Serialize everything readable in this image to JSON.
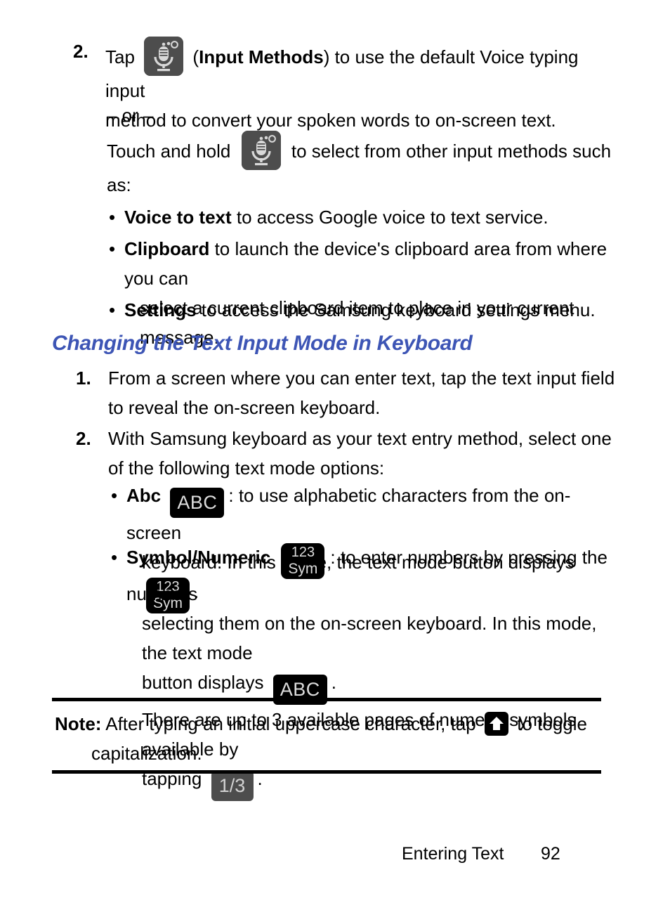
{
  "page": {
    "number": "92",
    "footer_section": "Entering Text"
  },
  "step2_input_methods": {
    "marker": "2.",
    "text_before_icon": "Tap",
    "icon": "microphone-input-methods-icon",
    "text_after_icon_bold": "Input Methods",
    "text_line1_tail": ") to use the default Voice typing input",
    "text_line2": "method to convert your spoken words to on-screen text.",
    "open_paren": "(",
    "or_separator": "– or –",
    "touch_hold_before": "Touch and hold",
    "touch_hold_icon": "microphone-input-methods-icon",
    "touch_hold_after": "to select from other input methods such",
    "touch_hold_line2": "as:"
  },
  "input_method_bullets": [
    {
      "bullet": "•",
      "term": "Voice to text",
      "description": " to access Google voice to text service."
    },
    {
      "bullet": "•",
      "term": "Clipboard",
      "description": " to launch the device's clipboard area from where you can",
      "description_line2": "select a current clipboard item to place in your current message."
    },
    {
      "bullet": "•",
      "term": "Settings",
      "description": " to access the Samsung keyboard settings menu."
    }
  ],
  "section_heading": "Changing the Text Input Mode in Keyboard",
  "mode_steps": [
    {
      "marker": "1.",
      "line1": "From a screen where you can enter text, tap the text input field",
      "line2": "to reveal the on-screen keyboard."
    },
    {
      "marker": "2.",
      "line1": "With Samsung keyboard as your text entry method, select one",
      "line2": "of the following text mode options:"
    }
  ],
  "mode_bullets": [
    {
      "bullet": "•",
      "term": "Abc",
      "key_label": "ABC",
      "key_name": "abc-key",
      "text_after_key": ": to use alphabetic characters from the on-screen",
      "line2_before_key": "keyboard. In this mode, the text mode button displays",
      "line2_key_top": "123",
      "line2_key_bottom": "Sym",
      "line2_key_name": "sym-key",
      "line2_after_key": "."
    },
    {
      "bullet": "•",
      "term": "Symbol/Numeric",
      "key_top": "123",
      "key_bottom": "Sym",
      "key_name": "sym-key",
      "text_after_key": ": to enter numbers by pressing the numbers",
      "line2": "selecting them on the on-screen keyboard. In this mode, the text mode",
      "line3_before_key": "button displays",
      "line3_key_label": "ABC",
      "line3_key_name": "abc-key",
      "line3_after_key": ".",
      "line4": "There are up to 3 available pages of numeric symbols available by",
      "line5_before_key": "tapping",
      "line5_key_label": "1/3",
      "line5_key_name": "page-count-key",
      "line5_after_key": "."
    }
  ],
  "note": {
    "label": "Note:",
    "text_before_icon": "After typing an initial uppercase character, tap",
    "icon": "shift-key-icon",
    "text_after_icon": "to toggle",
    "line2": "capitalization."
  },
  "colors": {
    "heading_blue": "#3d55b5",
    "key_black": "#000000",
    "key_gray": "#4d4d4d",
    "key_text_light": "#dcdcdc",
    "body_black": "#000000"
  }
}
